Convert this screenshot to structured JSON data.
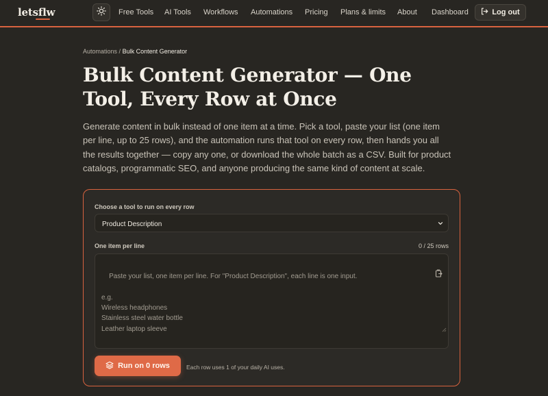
{
  "header": {
    "logo": "letsflw",
    "theme_toggle_icon": "sun-icon",
    "nav": [
      {
        "label": "Free Tools"
      },
      {
        "label": "AI Tools"
      },
      {
        "label": "Workflows"
      },
      {
        "label": "Automations"
      },
      {
        "label": "Pricing"
      },
      {
        "label": "Plans & limits"
      },
      {
        "label": "About"
      },
      {
        "label": "Dashboard"
      }
    ],
    "logout_label": "Log out",
    "logout_icon": "logout-icon"
  },
  "breadcrumb": {
    "parent": "Automations",
    "separator": "/",
    "current": "Bulk Content Generator"
  },
  "page": {
    "title": "Bulk Content Generator — One Tool, Every Row at Once",
    "intro": "Generate content in bulk instead of one item at a time. Pick a tool, paste your list (one item per line, up to 25 rows), and the automation runs that tool on every row, then hands you all the results together — copy any one, or download the whole batch as a CSV. Built for product catalogs, programmatic SEO, and anyone producing the same kind of content at scale."
  },
  "form": {
    "tool_label": "Choose a tool to run on every row",
    "tool_selected": "Product Description",
    "list_label": "One item per line",
    "row_counter": "0 / 25 rows",
    "textarea_placeholder": "Paste your list, one item per line. For \"Product Description\", each line is one input.\n\ne.g.\nWireless headphones\nStainless steel water bottle\nLeather laptop sleeve",
    "run_label": "Run on 0 rows",
    "run_note": "Each row uses 1 of your daily AI uses."
  },
  "colors": {
    "accent": "#df6a47",
    "background": "#282622"
  }
}
